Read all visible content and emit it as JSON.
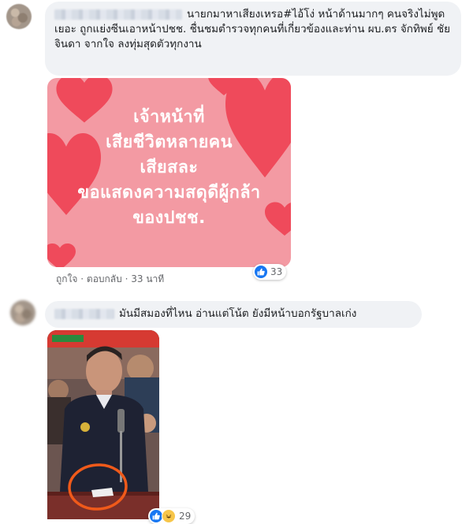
{
  "comment1": {
    "text": "นายกมาหาเสียงเหรอ#ไอ้โง่ หน้าด้านมากๆ คนจริงไม่พูดเยอะ ถูกแย่งซีนเอาหน้าปชช. ชื่นชมตำรวจทุกคนที่เกี่ยวข้องและท่าน ผบ.ตร จักทิพย์ ชัยจินดา จากใจ ลงทุ่มสุดตัวทุกงาน",
    "image_text": [
      "เจ้าหน้าที่",
      "เสียชีวิตหลายคน",
      "เสียสละ",
      "ขอแสดงความสดุดีผู้กล้า",
      "ของปชช."
    ],
    "like_label": "ถูกใจ",
    "separator": "·",
    "reply_label": "ตอบกลับ",
    "time": "33 นาที",
    "reaction_count": "33",
    "reaction_icons": [
      "like-icon"
    ]
  },
  "comment2": {
    "text": "มันมีสมองที่ไหน อ่านแต่โน้ต ยังมีหน้าบอกรัฐบาลเก่ง",
    "reaction_count": "29",
    "reaction_icons": [
      "like-icon",
      "haha-icon"
    ]
  },
  "colors": {
    "bubble": "#f0f2f5",
    "meta": "#65676b",
    "like_blue": "#1877f2",
    "card_pink": "#f39aa3",
    "heart_red": "#ef4a5b",
    "circle_orange": "#f05a1a"
  }
}
